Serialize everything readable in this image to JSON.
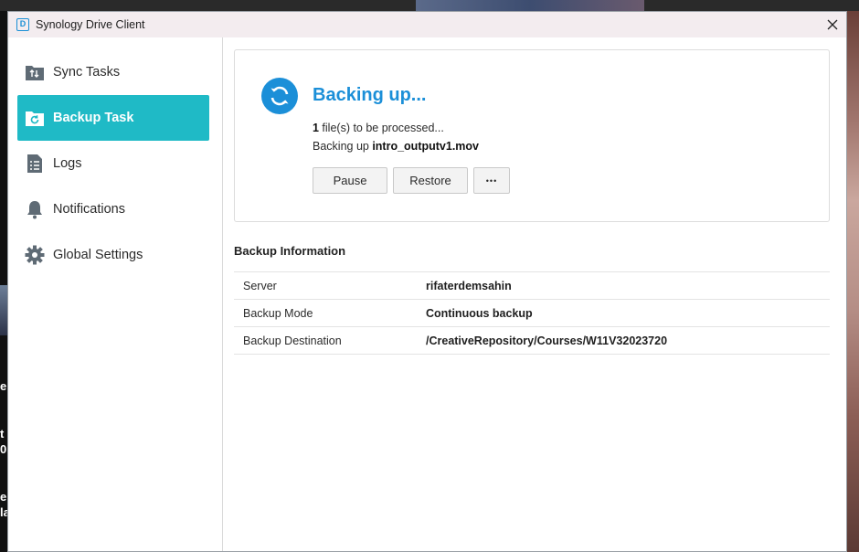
{
  "window": {
    "title": "Synology Drive Client"
  },
  "sidebar": {
    "items": [
      {
        "label": "Sync Tasks",
        "icon": "sync-tasks-icon",
        "active": false
      },
      {
        "label": "Backup Task",
        "icon": "backup-task-icon",
        "active": true
      },
      {
        "label": "Logs",
        "icon": "logs-icon",
        "active": false
      },
      {
        "label": "Notifications",
        "icon": "bell-icon",
        "active": false
      },
      {
        "label": "Global Settings",
        "icon": "gear-icon",
        "active": false
      }
    ]
  },
  "status": {
    "title": "Backing up...",
    "files_count": "1",
    "files_text": " file(s) to be processed...",
    "backing_prefix": "Backing up ",
    "backing_file": "intro_outputv1.mov",
    "buttons": {
      "pause": "Pause",
      "restore": "Restore",
      "more": "•••"
    }
  },
  "backup_info": {
    "title": "Backup Information",
    "rows": [
      {
        "key": "Server",
        "value": "rifaterdemsahin"
      },
      {
        "key": "Backup Mode",
        "value": "Continuous backup"
      },
      {
        "key": "Backup Destination",
        "value": "/CreativeRepository/Courses/W11V32023720"
      }
    ]
  },
  "colors": {
    "accent": "#1fbac6",
    "status_blue": "#1b8fd8"
  },
  "background": {
    "left_fragments": [
      "e",
      "t",
      "0",
      "e",
      "la"
    ]
  }
}
